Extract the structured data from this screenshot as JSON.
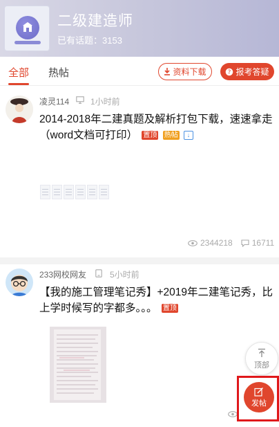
{
  "forum": {
    "title": "二级建造师",
    "topic_count": "已有话题：3153"
  },
  "tabs": [
    {
      "label": "全部",
      "active": true
    },
    {
      "label": "热帖",
      "active": false
    }
  ],
  "actions": {
    "download_label": "资料下载",
    "register_label": "报考答疑"
  },
  "posts": [
    {
      "author": "凌灵114",
      "device_icon": "desktop-icon",
      "time": "1小时前",
      "title": "2014-2018年二建真题及解析打包下载，速速拿走（word文档可打印）",
      "tags": [
        "置顶",
        "热帖"
      ],
      "views": "2344218",
      "comments": "16711",
      "attachments": 6
    },
    {
      "author": "233网校网友",
      "device_icon": "tablet-icon",
      "time": "5小时前",
      "title": "【我的施工管理笔记秀】+2019年二建笔记秀，比上学时候写的字都多。。。",
      "tags": [
        "置顶"
      ]
    }
  ],
  "fab": {
    "top_label": "顶部",
    "post_label": "发帖"
  },
  "colors": {
    "accent": "#e0462d",
    "header_gradient_start": "#d9d8e6",
    "header_gradient_end": "#b6b7d6"
  }
}
